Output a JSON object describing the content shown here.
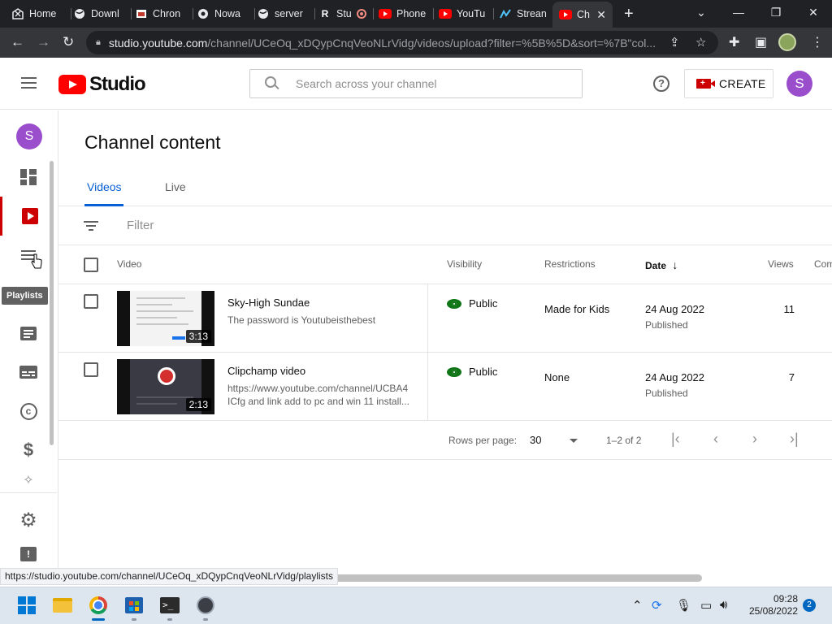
{
  "browser": {
    "tabs": [
      {
        "title": "Home",
        "icon": "home-favicon"
      },
      {
        "title": "Downl",
        "icon": "globe-favicon"
      },
      {
        "title": "Chron",
        "icon": "image-favicon"
      },
      {
        "title": "Nowa",
        "icon": "chromium-favicon"
      },
      {
        "title": "server",
        "icon": "globe-favicon"
      },
      {
        "title": "Stu",
        "icon": "r-favicon"
      },
      {
        "title": "Phone",
        "icon": "youtube-favicon"
      },
      {
        "title": "YouTu",
        "icon": "youtube-favicon"
      },
      {
        "title": "Strean",
        "icon": "stream-favicon"
      },
      {
        "title": "Ch",
        "icon": "youtube-favicon",
        "active": true
      }
    ],
    "url_main": "studio.youtube.com",
    "url_rest": "/channel/UCeOq_xDQypCnqVeoNLrVidg/videos/upload?filter=%5B%5D&sort=%7B\"col...",
    "status_url": "https://studio.youtube.com/channel/UCeOq_xDQypCnqVeoNLrVidg/playlists"
  },
  "header": {
    "logo_text": "Studio",
    "search_placeholder": "Search across your channel",
    "help_label": "?",
    "create_label": "CREATE",
    "avatar_letter": "S"
  },
  "rail": {
    "avatar_letter": "S",
    "tooltip": "Playlists"
  },
  "main": {
    "title": "Channel content",
    "tabs": [
      {
        "label": "Videos",
        "active": true
      },
      {
        "label": "Live"
      }
    ],
    "filter_label": "Filter",
    "columns": {
      "video": "Video",
      "visibility": "Visibility",
      "restrictions": "Restrictions",
      "date": "Date",
      "views": "Views",
      "comments": "Com"
    },
    "rows": [
      {
        "title": "Sky-High Sundae",
        "desc1": "The password is Youtubeisthebest",
        "desc2": "",
        "duration": "3:13",
        "visibility": "Public",
        "restrictions": "Made for Kids",
        "date": "24 Aug 2022",
        "date_status": "Published",
        "views": "11"
      },
      {
        "title": "Clipchamp video",
        "desc1": "https://www.youtube.com/channel/UCBA4",
        "desc2": "ICfg and link add to pc and win 11 install...",
        "duration": "2:13",
        "visibility": "Public",
        "restrictions": "None",
        "date": "24 Aug 2022",
        "date_status": "Published",
        "views": "7"
      }
    ],
    "pager": {
      "rows_per_page_label": "Rows per page:",
      "rows_per_page": "30",
      "range": "1–2 of 2"
    }
  },
  "taskbar": {
    "time": "09:28",
    "date": "25/08/2022",
    "notifications": "2"
  },
  "colors": {
    "accent_blue": "#065fd4",
    "youtube_red": "#ff0000",
    "public_green": "#107516",
    "avatar_purple": "#9a4ecb"
  }
}
